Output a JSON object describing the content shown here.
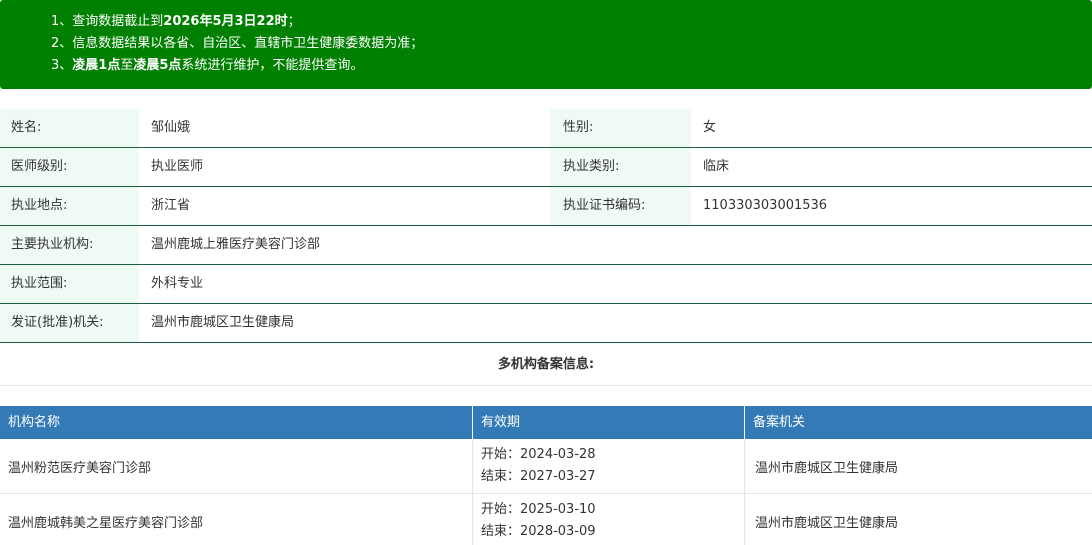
{
  "notice": {
    "line1_prefix": "1、查询数据截止到",
    "line1_bold": "2026年5月3日22时",
    "line1_suffix": "；",
    "line2": "2、信息数据结果以各省、自治区、直辖市卫生健康委数据为准；",
    "line3_prefix": "3、",
    "line3_bold1": "凌晨1点",
    "line3_mid": "至",
    "line3_bold2": "凌晨5点",
    "line3_suffix": "系统进行维护，不能提供查询。"
  },
  "info": {
    "name_label": "姓名:",
    "name_value": "邹仙娥",
    "gender_label": "性别:",
    "gender_value": "女",
    "level_label": "医师级别:",
    "level_value": "执业医师",
    "category_label": "执业类别:",
    "category_value": "临床",
    "location_label": "执业地点:",
    "location_value": "浙江省",
    "cert_label": "执业证书编码:",
    "cert_value": "110330303001536",
    "org_label": "主要执业机构:",
    "org_value": "温州鹿城上雅医疗美容门诊部",
    "scope_label": "执业范围:",
    "scope_value": "外科专业",
    "issuer_label": "发证(批准)机关:",
    "issuer_value": "温州市鹿城区卫生健康局"
  },
  "multi_title": "多机构备案信息:",
  "registrations": {
    "headers": [
      "机构名称",
      "有效期",
      "备案机关"
    ],
    "rows": [
      {
        "org": "温州粉范医疗美容门诊部",
        "start": "开始：2024-03-28",
        "end": "结束：2027-03-27",
        "authority": "温州市鹿城区卫生健康局"
      },
      {
        "org": "温州鹿城韩美之星医疗美容门诊部",
        "start": "开始：2025-03-10",
        "end": "结束：2028-03-09",
        "authority": "温州市鹿城区卫生健康局"
      }
    ]
  },
  "colors": {
    "notice_bg": "#008000",
    "label_bg": "#eefaf3",
    "table_header_bg": "#337ab7"
  }
}
